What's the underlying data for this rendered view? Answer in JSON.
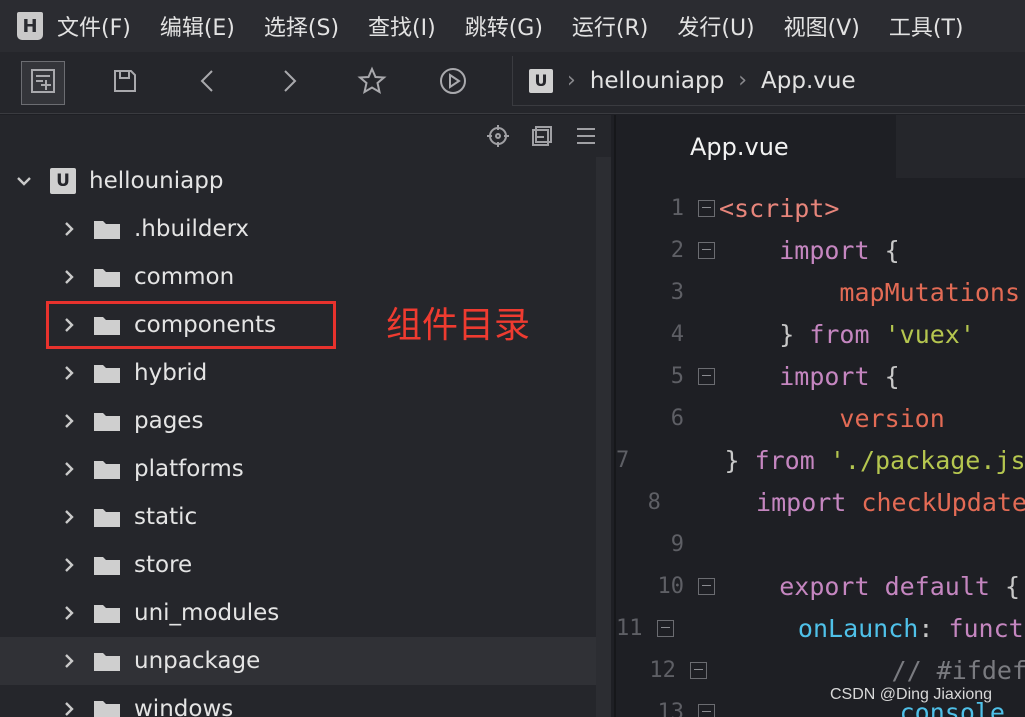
{
  "app": {
    "logo_letter": "H"
  },
  "menu": [
    "文件(F)",
    "编辑(E)",
    "选择(S)",
    "查找(I)",
    "跳转(G)",
    "运行(R)",
    "发行(U)",
    "视图(V)",
    "工具(T)"
  ],
  "breadcrumb": {
    "icon_letter": "U",
    "project": "hellouniapp",
    "file": "App.vue"
  },
  "sidebar": {
    "root": {
      "icon_letter": "U",
      "label": "hellouniapp"
    },
    "items": [
      {
        "label": ".hbuilderx"
      },
      {
        "label": "common"
      },
      {
        "label": "components"
      },
      {
        "label": "hybrid"
      },
      {
        "label": "pages"
      },
      {
        "label": "platforms"
      },
      {
        "label": "static"
      },
      {
        "label": "store"
      },
      {
        "label": "uni_modules"
      },
      {
        "label": "unpackage"
      },
      {
        "label": "windows"
      }
    ],
    "selected_item": "unpackage"
  },
  "annotation": {
    "text": "组件目录",
    "color": "#e8322d"
  },
  "editor": {
    "tab": "App.vue",
    "lines": [
      {
        "n": "1",
        "fold": true,
        "parts": [
          [
            "c-tag",
            "<script>"
          ]
        ]
      },
      {
        "n": "2",
        "fold": true,
        "parts": [
          [
            "c-punc",
            "    "
          ],
          [
            "c-kw",
            "import"
          ],
          [
            "c-punc",
            " {"
          ]
        ]
      },
      {
        "n": "3",
        "fold": false,
        "parts": [
          [
            "c-punc",
            "        "
          ],
          [
            "c-var",
            "mapMutations"
          ]
        ]
      },
      {
        "n": "4",
        "fold": false,
        "parts": [
          [
            "c-punc",
            "    } "
          ],
          [
            "c-kw",
            "from"
          ],
          [
            "c-punc",
            " "
          ],
          [
            "c-str",
            "'vuex'"
          ]
        ]
      },
      {
        "n": "5",
        "fold": true,
        "parts": [
          [
            "c-punc",
            "    "
          ],
          [
            "c-kw",
            "import"
          ],
          [
            "c-punc",
            " {"
          ]
        ]
      },
      {
        "n": "6",
        "fold": false,
        "parts": [
          [
            "c-punc",
            "        "
          ],
          [
            "c-var",
            "version"
          ]
        ]
      },
      {
        "n": "7",
        "fold": false,
        "parts": [
          [
            "c-punc",
            "    } "
          ],
          [
            "c-kw",
            "from"
          ],
          [
            "c-punc",
            " "
          ],
          [
            "c-str",
            "'./package.json'"
          ]
        ]
      },
      {
        "n": "8",
        "fold": false,
        "parts": [
          [
            "c-punc",
            "    "
          ],
          [
            "c-kw",
            "import"
          ],
          [
            "c-punc",
            " "
          ],
          [
            "c-var",
            "checkUpdate"
          ]
        ]
      },
      {
        "n": "9",
        "fold": false,
        "parts": []
      },
      {
        "n": "10",
        "fold": true,
        "parts": [
          [
            "c-punc",
            "    "
          ],
          [
            "c-kw",
            "export default"
          ],
          [
            "c-punc",
            " {"
          ]
        ]
      },
      {
        "n": "11",
        "fold": true,
        "parts": [
          [
            "c-punc",
            "        "
          ],
          [
            "c-fn",
            "onLaunch"
          ],
          [
            "c-punc",
            ": "
          ],
          [
            "c-kw",
            "function"
          ]
        ]
      },
      {
        "n": "12",
        "fold": true,
        "parts": [
          [
            "c-punc",
            "            "
          ],
          [
            "c-com",
            "// #ifdef"
          ]
        ]
      },
      {
        "n": "13",
        "fold": true,
        "parts": [
          [
            "c-punc",
            "            "
          ],
          [
            "c-fn",
            "console"
          ]
        ]
      }
    ]
  },
  "watermark": "CSDN @Ding Jiaxiong"
}
